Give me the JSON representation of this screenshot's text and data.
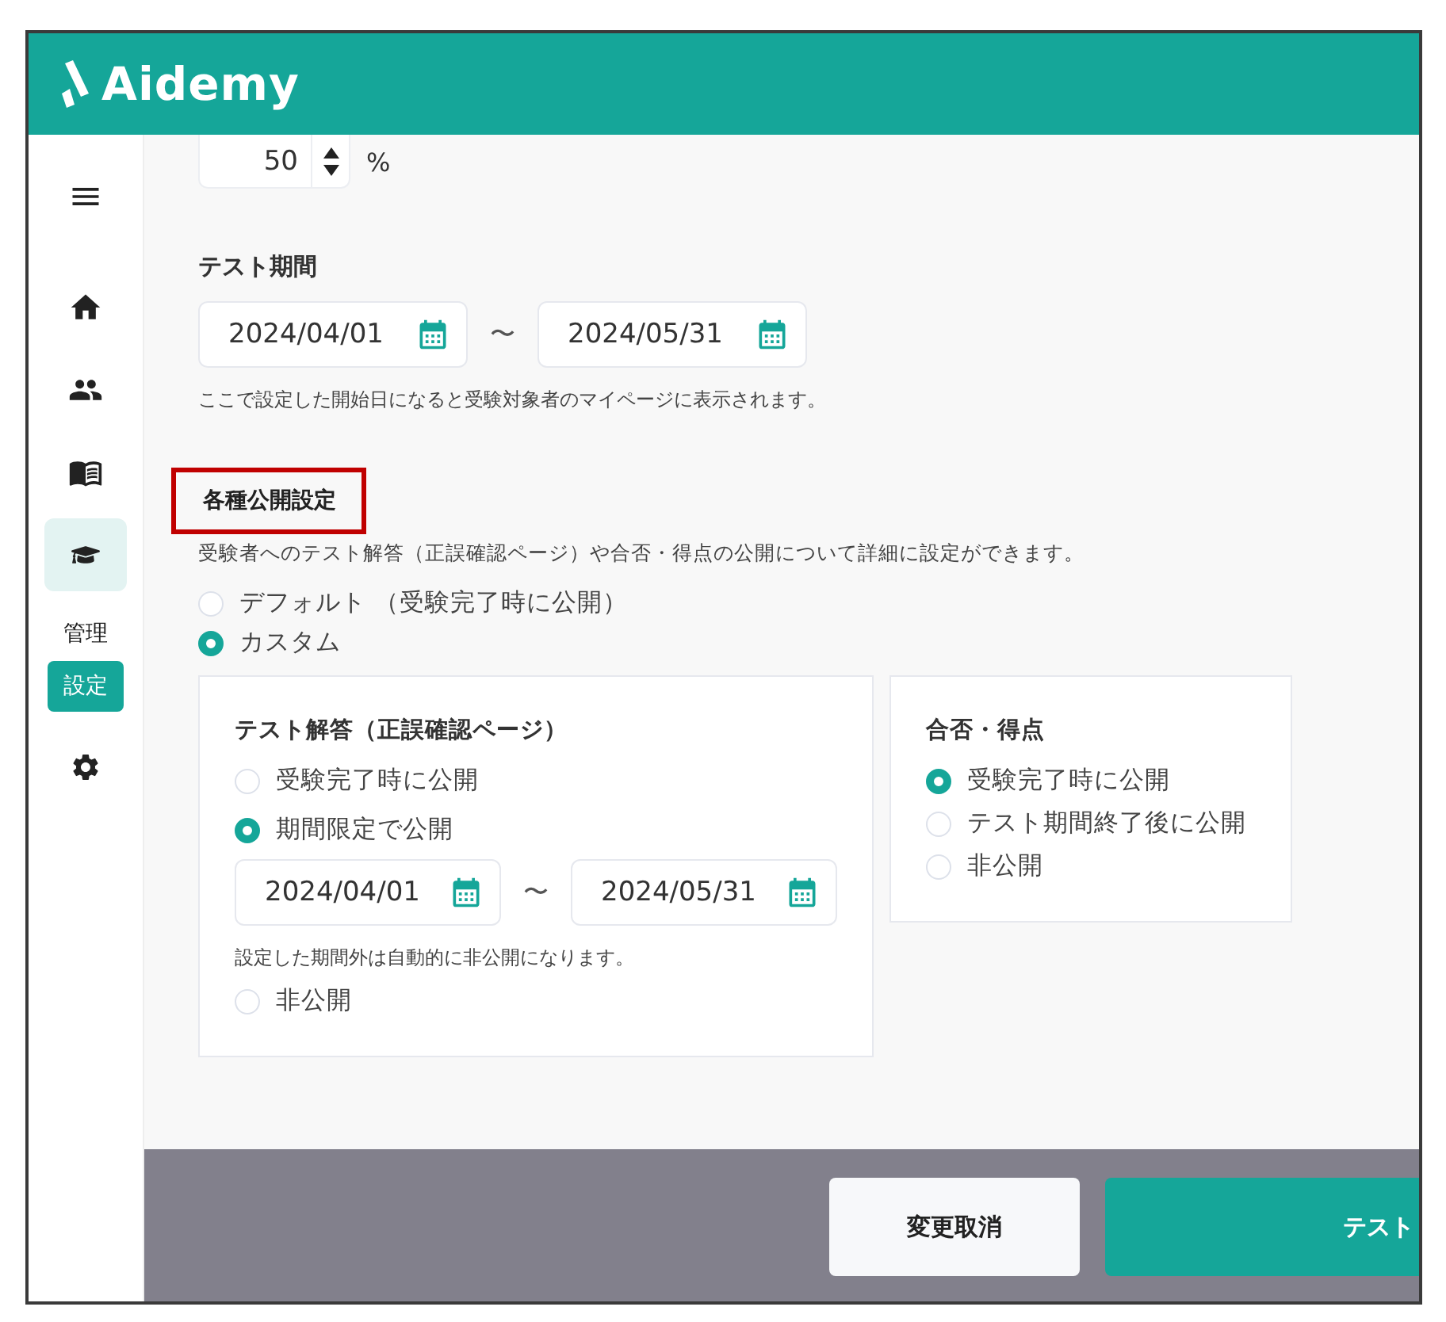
{
  "header": {
    "logo": "Aidemy"
  },
  "sidebar": {
    "nav": [
      {
        "selected": false
      },
      {
        "selected": false
      },
      {
        "selected": false
      },
      {
        "selected": false
      },
      {
        "selected": true
      }
    ],
    "section_label": "管理",
    "section_badge": "設定"
  },
  "score_input": {
    "value": "50",
    "unit": "%"
  },
  "test_period": {
    "label": "テスト期間",
    "start": "2024/04/01",
    "separator": "〜",
    "end": "2024/05/31",
    "note": "ここで設定した開始日になると受験対象者のマイページに表示されます。"
  },
  "publish_settings": {
    "title": "各種公開設定",
    "highlighted": true,
    "description": "受験者へのテスト解答（正誤確認ページ）や合否・得点の公開について詳細に設定ができます。",
    "modes": [
      {
        "label": "デフォルト （受験完了時に公開）",
        "selected": false
      },
      {
        "label": "カスタム",
        "selected": true
      }
    ],
    "cards": [
      {
        "title": "テスト解答（正誤確認ページ）",
        "options": [
          {
            "kind": "plain",
            "label": "受験完了時に公開",
            "selected": false
          },
          {
            "kind": "period",
            "label": "期間限定で公開",
            "selected": true,
            "start": "2024/04/01",
            "separator": "〜",
            "end": "2024/05/31",
            "note": "設定した期間外は自動的に非公開になります。"
          },
          {
            "kind": "plain",
            "label": "非公開",
            "selected": false
          }
        ]
      },
      {
        "title": "合否・得点",
        "options": [
          {
            "kind": "plain",
            "label": "受験完了時に公開",
            "selected": true
          },
          {
            "kind": "plain",
            "label": "テスト期間終了後に公開",
            "selected": false
          },
          {
            "kind": "plain",
            "label": "非公開",
            "selected": false
          }
        ]
      }
    ]
  },
  "footer": {
    "buttons": [
      {
        "kind": "secondary",
        "label": "変更取消"
      },
      {
        "kind": "primary",
        "label": "テスト"
      }
    ]
  }
}
